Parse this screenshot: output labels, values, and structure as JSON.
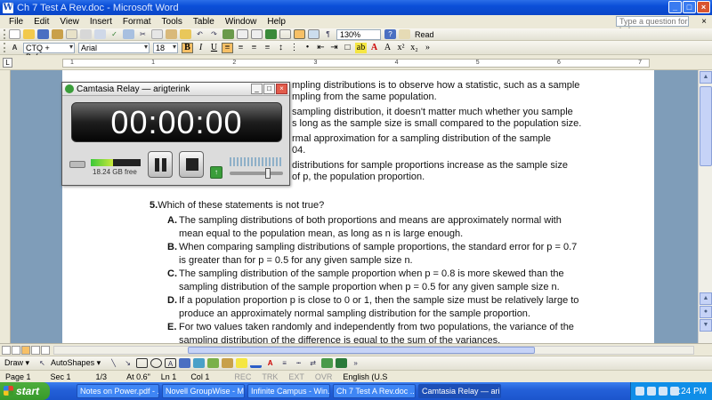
{
  "window": {
    "title": "Ch 7 Test A Rev.doc - Microsoft Word",
    "app_icon": "W"
  },
  "menu": {
    "items": [
      "File",
      "Edit",
      "View",
      "Insert",
      "Format",
      "Tools",
      "Table",
      "Window",
      "Help"
    ],
    "help_placeholder": "Type a question for help"
  },
  "toolbar": {
    "zoom": "130%",
    "read_label": "Read",
    "style": "CTQ + Before:",
    "font": "Arial",
    "size": "18"
  },
  "ruler": {
    "numbers": [
      "1",
      "1",
      "2",
      "3",
      "4",
      "5",
      "6",
      "7"
    ]
  },
  "document": {
    "fragments": [
      "mpling distributions is to observe how a statistic, such as a sample",
      "mpling from the same population.",
      "sampling distribution, it doesn't matter much whether you sample",
      "s long as the sample size is small compared to the population size.",
      "rmal approximation for a sampling distribution of the sample",
      "04.",
      "distributions for sample proportions increase as the sample size",
      "of p, the population proportion."
    ],
    "question": {
      "number": "5.",
      "text": "Which of these statements is not true?"
    },
    "options": [
      {
        "letter": "A.",
        "text": "The sampling distributions of both proportions and means are approximately normal with mean equal to the population mean, as long as n is large enough."
      },
      {
        "letter": "B.",
        "text": "When comparing sampling distributions of sample proportions, the standard error for p = 0.7 is greater than for p = 0.5 for any given sample size n."
      },
      {
        "letter": "C.",
        "text": "The sampling distribution of the sample proportion when p = 0.8 is more skewed than the sampling distribution of the sample proportion when p = 0.5 for any given sample size n."
      },
      {
        "letter": "D.",
        "text": "If a population proportion p is close to 0 or 1, then the sample size must be relatively large to produce an approximately normal sampling distribution for the sample proportion."
      },
      {
        "letter": "E.",
        "text": "For two values taken randomly and independently from two populations, the variance of the sampling distribution of the difference is equal to the sum of the variances."
      }
    ]
  },
  "camtasia": {
    "title": "Camtasia Relay — arigterink",
    "timer": "00:00:00",
    "disk_free": "18.24 GB free",
    "meter_fill": 0.45
  },
  "drawbar": {
    "draw": "Draw ▾",
    "autoshapes": "AutoShapes ▾"
  },
  "status": {
    "page": "Page 1",
    "sec": "Sec 1",
    "pages": "1/3",
    "at": "At 0.6\"",
    "ln": "Ln 1",
    "col": "Col 1",
    "rec": "REC",
    "trk": "TRK",
    "ext": "EXT",
    "ovr": "OVR",
    "lang": "English (U.S"
  },
  "taskbar": {
    "start": "start",
    "tasks": [
      "Notes on Power.pdf - ...",
      "Novell GroupWise - M...",
      "Infinite Campus - Win...",
      "Ch 7 Test A Rev.doc ...",
      "Camtasia Relay — ari..."
    ],
    "clock": "2:24 PM"
  }
}
